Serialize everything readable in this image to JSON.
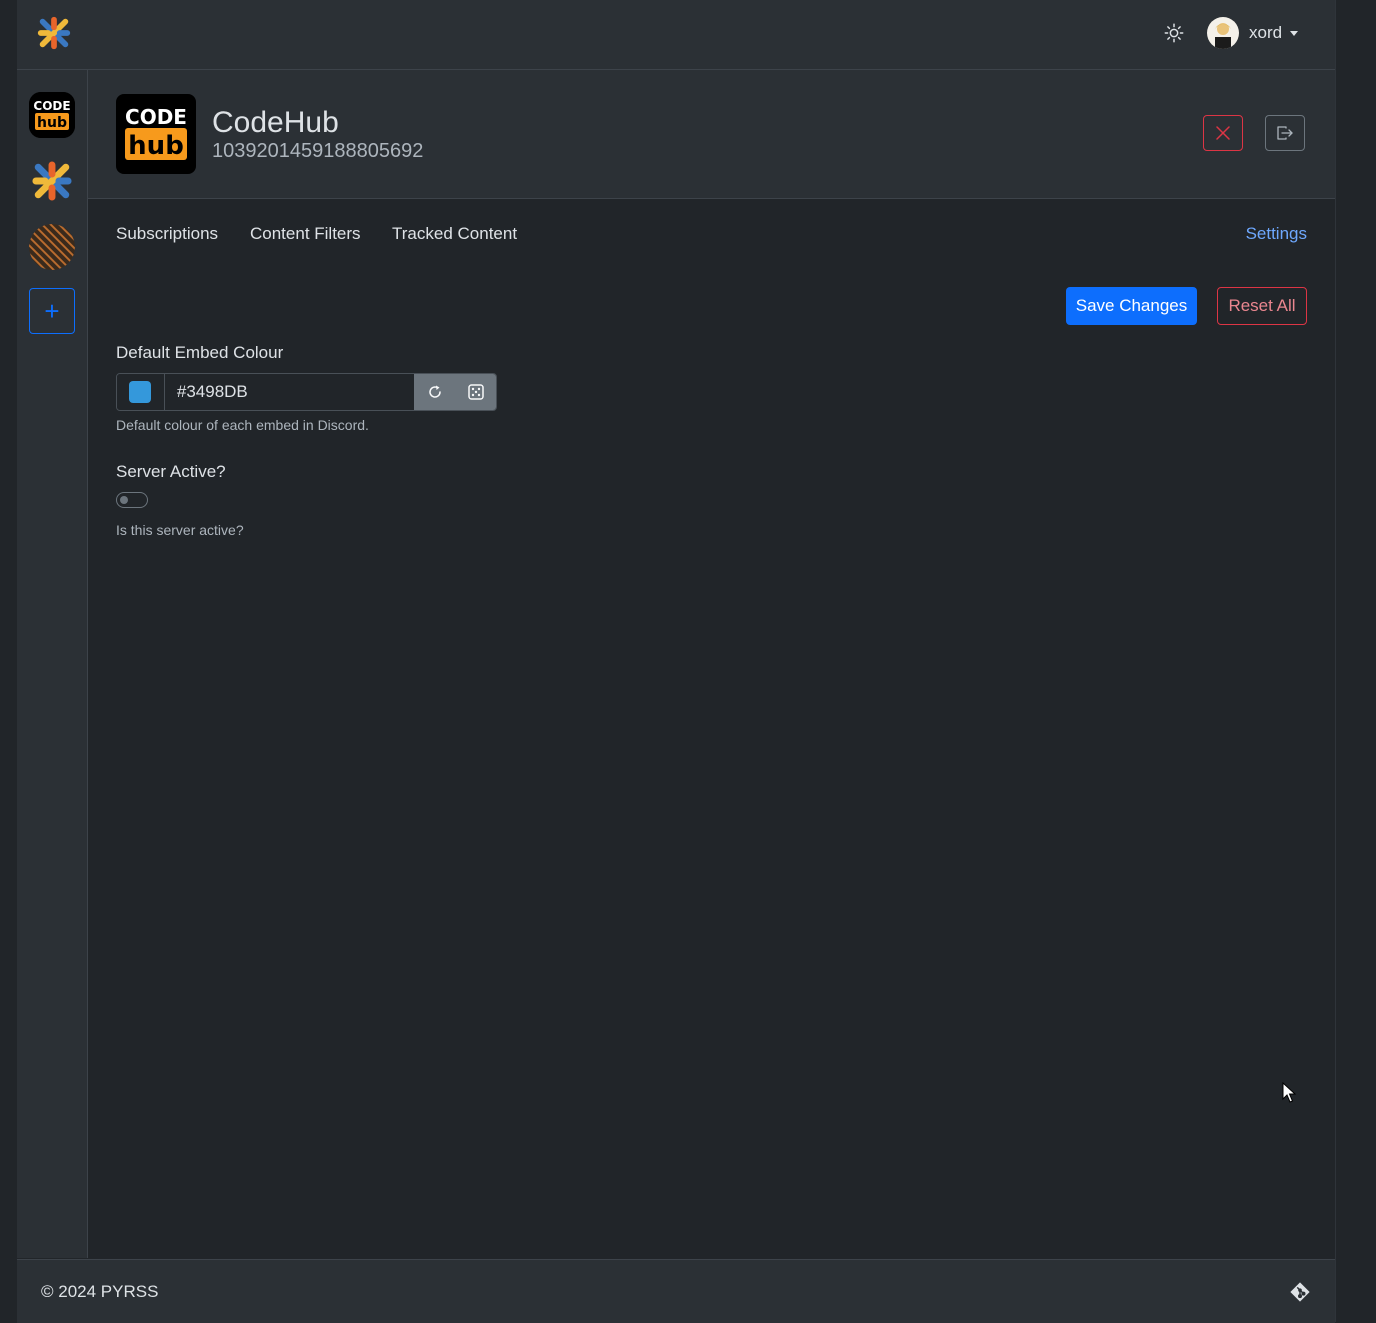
{
  "navbar": {
    "brand_icon": "pyrss-logo",
    "theme_icon": "sun-icon",
    "user": {
      "name": "xord",
      "avatar": "user-avatar"
    }
  },
  "sidebar": {
    "guilds": [
      {
        "name": "CodeHub",
        "icon": "codehub-logo",
        "logo_top": "CODE",
        "logo_bottom": "hub"
      },
      {
        "name": "PYRSS",
        "icon": "pyrss-logo"
      },
      {
        "name": "Patterned server",
        "icon": "pattern-logo"
      }
    ],
    "add_label": "+"
  },
  "guild": {
    "name": "CodeHub",
    "id": "1039201459188805692",
    "logo_top": "CODE",
    "logo_bottom": "hub",
    "colors": {
      "delete": "#dc3545",
      "leave": "#6c757d"
    }
  },
  "tabs": [
    {
      "label": "Subscriptions"
    },
    {
      "label": "Content Filters"
    },
    {
      "label": "Tracked Content"
    },
    {
      "label": "Settings",
      "active": true
    }
  ],
  "actions": {
    "save": "Save Changes",
    "reset": "Reset All"
  },
  "settings": {
    "embed_colour": {
      "label": "Default Embed Colour",
      "value": "#3498DB",
      "help": "Default colour of each embed in Discord."
    },
    "server_active": {
      "label": "Server Active?",
      "checked": false,
      "help": "Is this server active?"
    }
  },
  "footer": {
    "copyright": "© 2024 PYRSS",
    "icon": "git-icon"
  },
  "theme": {
    "accent": "#0d6efd",
    "danger": "#dc3545",
    "bg": "#212529",
    "panel": "#2b3035"
  }
}
